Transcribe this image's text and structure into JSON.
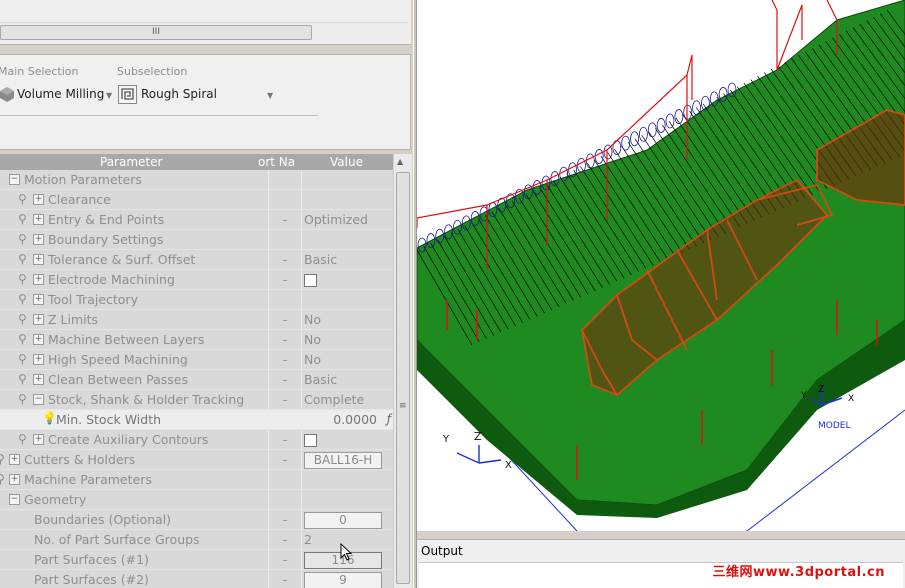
{
  "scroll": {
    "thumb_grip": "III"
  },
  "selection": {
    "main_caption": "Main Selection",
    "main_value": "Volume Milling",
    "sub_caption": "Subselection",
    "sub_value": "Rough Spiral"
  },
  "grid": {
    "headers": {
      "parameter": "Parameter",
      "port": "ort Na",
      "value": "Value"
    },
    "rows": [
      {
        "label": "Motion Parameters",
        "value": ""
      },
      {
        "label": "Clearance",
        "value": ""
      },
      {
        "label": "Entry & End Points",
        "port": "-",
        "value": "Optimized"
      },
      {
        "label": "Boundary Settings",
        "value": ""
      },
      {
        "label": "Tolerance & Surf. Offset",
        "port": "-",
        "value": "Basic"
      },
      {
        "label": "Electrode Machining",
        "port": "-",
        "value": ""
      },
      {
        "label": "Tool Trajectory",
        "value": ""
      },
      {
        "label": "Z Limits",
        "port": "-",
        "value": "No"
      },
      {
        "label": "Machine Between Layers",
        "port": "-",
        "value": "No"
      },
      {
        "label": "High Speed Machining",
        "port": "-",
        "value": "No"
      },
      {
        "label": "Clean Between Passes",
        "port": "-",
        "value": "Basic"
      },
      {
        "label": "Stock, Shank & Holder Tracking",
        "port": "-",
        "value": "Complete"
      },
      {
        "label": "Min. Stock Width",
        "port": "",
        "value": "0.0000",
        "fx": "ƒ"
      },
      {
        "label": "Create Auxiliary Contours",
        "port": "-",
        "value": ""
      },
      {
        "label": "Cutters & Holders",
        "port": "-",
        "value": "BALL16-H"
      },
      {
        "label": "Machine Parameters",
        "value": ""
      },
      {
        "label": "Geometry",
        "value": ""
      },
      {
        "label": "Boundaries (Optional)",
        "port": "-",
        "value": "0"
      },
      {
        "label": "No. of Part Surface Groups",
        "port": "-",
        "value": "2"
      },
      {
        "label": "Part Surfaces (#1)",
        "port": "-",
        "value": "116"
      },
      {
        "label": "Part Surfaces (#2)",
        "port": "-",
        "value": "9"
      }
    ]
  },
  "viewport": {
    "model_axis_labels": {
      "x": "X",
      "y": "Y",
      "z": "Z",
      "caption": "MODEL"
    },
    "world_axis_labels": {
      "x": "X",
      "y": "Y",
      "z": "Z"
    },
    "colors": {
      "surface": "#1f8a1f",
      "toolpath": "#000000",
      "part": "#d24a14",
      "boundary": "#e01010",
      "stock": "#2030d0"
    }
  },
  "output": {
    "title": "Output"
  },
  "watermark": "三维网www.3dportal.cn"
}
